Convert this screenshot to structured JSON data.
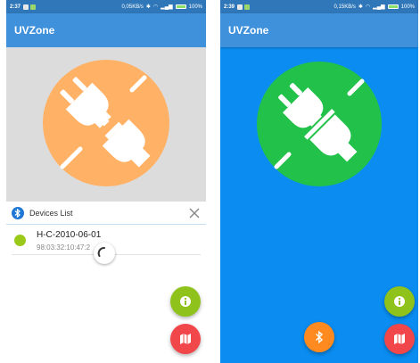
{
  "left_screen": {
    "status": {
      "time": "2:37",
      "speed": "0,05KB/s",
      "battery": "100%"
    },
    "app_title": "UVZone",
    "connection_state": "disconnected",
    "devices_panel": {
      "title": "Devices List",
      "devices": [
        {
          "name": "H-C-2010-06-01",
          "address": "98:03:32:10:47:2"
        }
      ]
    }
  },
  "right_screen": {
    "status": {
      "time": "2:39",
      "speed": "0,15KB/s",
      "battery": "100%"
    },
    "app_title": "UVZone",
    "connection_state": "connected"
  },
  "colors": {
    "status_bar": "#2f77b9",
    "app_bar": "#3f91dc",
    "disconnected_circle": "#ffb266",
    "connected_circle": "#22c24a",
    "right_background": "#0a8cf0",
    "info_fab": "#8fc21a",
    "map_fab": "#f2474a",
    "bluetooth_fab": "#ff8a1f",
    "device_dot": "#9bc91a"
  },
  "icons": [
    "plug-disconnected-icon",
    "plug-connected-icon",
    "bluetooth-icon",
    "close-icon",
    "info-icon",
    "map-icon",
    "loading-spinner-icon"
  ]
}
